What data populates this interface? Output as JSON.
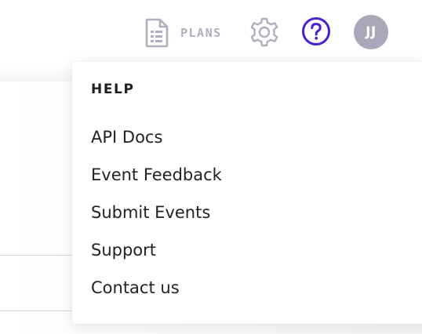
{
  "header": {
    "plans_label": "PLANS",
    "avatar_initials": "JJ"
  },
  "icons": {
    "plans": "document-list-icon",
    "settings": "gear-icon",
    "help": "question-circle-icon"
  },
  "colors": {
    "accent": "#4a1fd6",
    "muted_icon": "#b3aebf",
    "avatar_bg": "#aca6bb",
    "menu_text": "#222222"
  },
  "help_menu": {
    "title": "HELP",
    "items": [
      {
        "label": "API Docs"
      },
      {
        "label": "Event Feedback"
      },
      {
        "label": "Submit Events"
      },
      {
        "label": "Support"
      },
      {
        "label": "Contact us"
      }
    ]
  }
}
